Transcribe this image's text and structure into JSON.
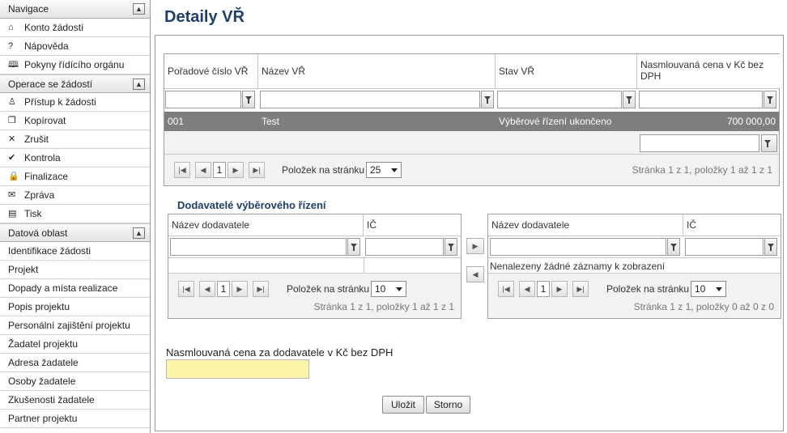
{
  "sidebar": {
    "navigace": {
      "title": "Navigace",
      "items": [
        {
          "label": "Konto žádostí",
          "icon": "home-icon",
          "glyph": "⌂"
        },
        {
          "label": "Nápověda",
          "icon": "help-icon",
          "glyph": "?"
        },
        {
          "label": "Pokyny řídícího orgánu",
          "icon": "book-icon",
          "glyph": "🕮"
        }
      ]
    },
    "operace": {
      "title": "Operace se žádostí",
      "items": [
        {
          "label": "Přístup k žádosti",
          "icon": "user-icon",
          "glyph": "♙"
        },
        {
          "label": "Kopírovat",
          "icon": "copy-icon",
          "glyph": "❐"
        },
        {
          "label": "Zrušit",
          "icon": "close-icon",
          "glyph": "✕"
        },
        {
          "label": "Kontrola",
          "icon": "check-icon",
          "glyph": "✔"
        },
        {
          "label": "Finalizace",
          "icon": "lock-icon",
          "glyph": "🔒"
        },
        {
          "label": "Zpráva",
          "icon": "mail-icon",
          "glyph": "✉"
        },
        {
          "label": "Tisk",
          "icon": "print-icon",
          "glyph": "▤"
        }
      ]
    },
    "datova": {
      "title": "Datová oblast",
      "items": [
        "Identifikace žádosti",
        "Projekt",
        "Dopady a místa realizace",
        "Popis projektu",
        "Personální zajištění projektu",
        "Žadatel projektu",
        "Adresa žadatele",
        "Osoby žadatele",
        "Zkušenosti žadatele",
        "Partner projektu"
      ]
    },
    "collapse_glyph": "▲"
  },
  "page_title": "Detaily VŘ",
  "vr_grid": {
    "columns": [
      "Pořadové číslo VŘ",
      "Název VŘ",
      "Stav VŘ",
      "Nasmlouvaná cena v Kč bez DPH"
    ],
    "rows": [
      {
        "cislo": "001",
        "nazev": "Test",
        "stav": "Výběrové řízení ukončeno",
        "cena": "700 000,00"
      }
    ],
    "pager": {
      "page": "1",
      "page_size_label": "Položek na stránku",
      "page_size": "25",
      "info": "Stránka 1 z 1, položky 1 až 1 z 1"
    }
  },
  "suppliers_title": "Dodavatelé výběrového řízení",
  "left_grid": {
    "columns": [
      "Název dodavatele",
      "IČ"
    ],
    "pager": {
      "page": "1",
      "page_size_label": "Položek na stránku",
      "page_size": "10",
      "info": "Stránka 1 z 1, položky 1 až 1 z 1"
    }
  },
  "right_grid": {
    "columns": [
      "Název dodavatele",
      "IČ"
    ],
    "empty_text": "Nenalezeny žádné záznamy k zobrazení",
    "pager": {
      "page": "1",
      "page_size_label": "Položek na stránku",
      "page_size": "10",
      "info": "Stránka 1 z 1, položky 0 až 0 z 0"
    }
  },
  "move": {
    "right_glyph": "▶",
    "left_glyph": "◀"
  },
  "pager_glyphs": {
    "first": "|◀",
    "prev": "◀",
    "next": "▶",
    "last": "▶|"
  },
  "price_label": "Nasmlouvaná cena za dodavatele v Kč bez DPH",
  "price_value": "",
  "buttons": {
    "save": "Uložit",
    "cancel": "Storno"
  },
  "colors": {
    "title": "#1f3f6a",
    "selected_row": "#7e7e7e",
    "price_input": "#fdf5a8"
  }
}
